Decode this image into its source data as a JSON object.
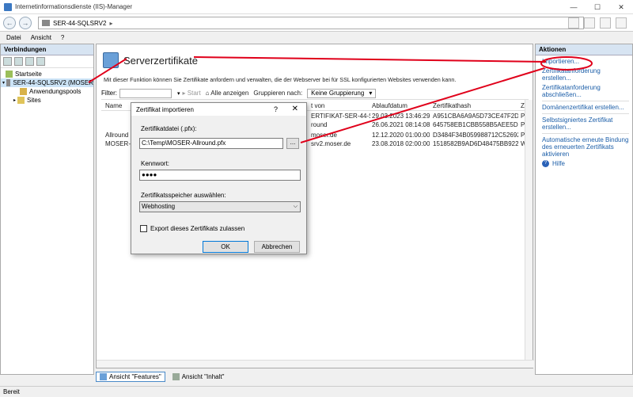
{
  "window": {
    "title": "Internetinformationsdienste (IIS)-Manager"
  },
  "address": {
    "server": "SER-44-SQLSRV2",
    "sep": "▸"
  },
  "menu": {
    "items": [
      "Datei",
      "Ansicht",
      "?"
    ]
  },
  "connections": {
    "header": "Verbindungen",
    "tree": {
      "start": "Startseite",
      "server": "SER-44-SQLSRV2 (MOSER",
      "apppools": "Anwendungspools",
      "sites": "Sites"
    }
  },
  "center": {
    "title": "Serverzertifikate",
    "description": "Mit dieser Funktion können Sie Zertifikate anfordern und verwalten, die der Webserver bei für SSL konfigurierten Websites verwenden kann.",
    "filter_label": "Filter:",
    "start_label": "Start",
    "show_all_label": "Alle anzeigen",
    "group_label": "Gruppieren nach:",
    "group_value": "Keine Gruppierung",
    "columns": [
      "Name",
      "t von",
      "Ablaufdatum",
      "Zertifikathash",
      "Z"
    ],
    "rows": [
      {
        "name": "",
        "issuer": "ERTIFIKAT-SER-44-S...",
        "expires": "29.03.2023 13:46:29",
        "hash": "A951CBA6A9A5D73CE47F2D8...",
        "z": "P"
      },
      {
        "name": "",
        "issuer": "round",
        "expires": "26.06.2021 08:14:08",
        "hash": "645758EB1CBB558B5AEE5D99...",
        "z": "P"
      },
      {
        "name": "Allround S",
        "issuer": "moser.de",
        "expires": "12.12.2020 01:00:00",
        "hash": "D3484F34B059988712C52692A...",
        "z": "P"
      },
      {
        "name": "MOSER-SQ",
        "issuer": "srv2.moser.de",
        "expires": "23.08.2018 02:00:00",
        "hash": "1518582B9AD6D48475BB922...",
        "z": "W"
      }
    ],
    "tabs": {
      "features": "Ansicht \"Features\"",
      "content": "Ansicht \"Inhalt\""
    }
  },
  "actions": {
    "header": "Aktionen",
    "import": "Importieren...",
    "request": "Zertifikatanforderung erstellen...",
    "complete": "Zertifikatanforderung abschließen...",
    "domain": "Domänenzertifikat erstellen...",
    "selfsigned": "Selbstsigniertes Zertifikat erstellen...",
    "renew": "Automatische erneute Bindung des erneuerten Zertifikats aktivieren",
    "help": "Hilfe"
  },
  "dialog": {
    "title": "Zertifikat importieren",
    "help_glyph": "?",
    "close_glyph": "✕",
    "file_label": "Zertifikatdatei (.pfx):",
    "file_value": "C:\\Temp\\MOSER-Allround.pfx",
    "browse_label": "...",
    "password_label": "Kennwort:",
    "password_value": "●●●●",
    "store_label": "Zertifikatsspeicher auswählen:",
    "store_value": "Webhosting",
    "export_label": "Export dieses Zertifikats zulassen",
    "export_checked": false,
    "ok_label": "OK",
    "cancel_label": "Abbrechen"
  },
  "status": {
    "text": "Bereit"
  },
  "colors": {
    "annotation": "#e0001a",
    "link": "#1c5ea8",
    "selection": "#cce4f7"
  }
}
